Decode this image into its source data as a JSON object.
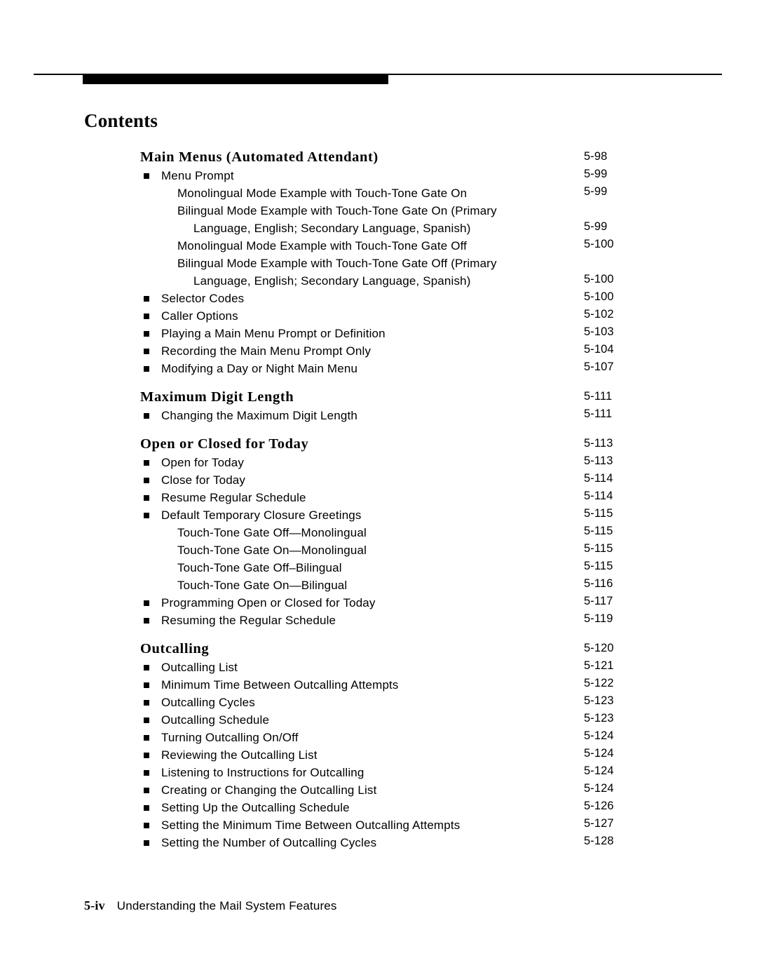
{
  "document": {
    "contents_title": "Contents",
    "footer": {
      "folio": "5-iv",
      "text": "Understanding the Mail System Features"
    }
  },
  "toc": {
    "entries": [
      {
        "type": "heading",
        "label": "Main Menus (Automated Attendant)",
        "page": "5-98"
      },
      {
        "type": "bullet",
        "label": "Menu Prompt",
        "page": "5-99"
      },
      {
        "type": "sub",
        "label": "Monolingual Mode Example with Touch-Tone Gate On",
        "page": "5-99"
      },
      {
        "type": "sub-wrap",
        "line1": "Bilingual Mode Example with Touch-Tone Gate On (Primary",
        "line2": "Language, English; Secondary Language, Spanish)",
        "page": "5-99"
      },
      {
        "type": "sub",
        "label": "Monolingual Mode Example with Touch-Tone Gate Off",
        "page": "5-100"
      },
      {
        "type": "sub-wrap",
        "line1": "Bilingual Mode Example with Touch-Tone Gate Off (Primary",
        "line2": "Language, English; Secondary Language, Spanish)",
        "page": "5-100"
      },
      {
        "type": "bullet",
        "label": "Selector Codes",
        "page": "5-100"
      },
      {
        "type": "bullet",
        "label": "Caller Options",
        "page": "5-102"
      },
      {
        "type": "bullet",
        "label": "Playing a Main Menu Prompt or Definition",
        "page": "5-103"
      },
      {
        "type": "bullet",
        "label": "Recording the Main Menu Prompt Only",
        "page": "5-104"
      },
      {
        "type": "bullet",
        "label": "Modifying a Day or Night Main Menu",
        "page": "5-107"
      },
      {
        "type": "heading",
        "label": "Maximum Digit Length",
        "page": "5-111"
      },
      {
        "type": "bullet",
        "label": "Changing the Maximum Digit Length",
        "page": "5-111"
      },
      {
        "type": "heading",
        "label": "Open or Closed for Today",
        "page": "5-113"
      },
      {
        "type": "bullet",
        "label": "Open for Today",
        "page": "5-113"
      },
      {
        "type": "bullet",
        "label": "Close for Today",
        "page": "5-114"
      },
      {
        "type": "bullet",
        "label": "Resume Regular Schedule",
        "page": "5-114"
      },
      {
        "type": "bullet",
        "label": "Default Temporary Closure Greetings",
        "page": "5-115"
      },
      {
        "type": "sub",
        "label": "Touch-Tone Gate Off—Monolingual",
        "page": "5-115"
      },
      {
        "type": "sub",
        "label": "Touch-Tone Gate On—Monolingual",
        "page": "5-115"
      },
      {
        "type": "sub",
        "label": "Touch-Tone Gate Off–Bilingual",
        "page": "5-115"
      },
      {
        "type": "sub",
        "label": "Touch-Tone Gate On—Bilingual",
        "page": "5-116"
      },
      {
        "type": "bullet",
        "label": "Programming Open or Closed for Today",
        "page": "5-117"
      },
      {
        "type": "bullet",
        "label": "Resuming the Regular Schedule",
        "page": "5-119"
      },
      {
        "type": "heading",
        "label": "Outcalling",
        "page": "5-120"
      },
      {
        "type": "bullet",
        "label": "Outcalling List",
        "page": "5-121"
      },
      {
        "type": "bullet",
        "label": "Minimum Time Between Outcalling Attempts",
        "page": "5-122"
      },
      {
        "type": "bullet",
        "label": "Outcalling Cycles",
        "page": "5-123"
      },
      {
        "type": "bullet",
        "label": "Outcalling Schedule",
        "page": "5-123"
      },
      {
        "type": "bullet",
        "label": "Turning Outcalling On/Off",
        "page": "5-124"
      },
      {
        "type": "bullet",
        "label": "Reviewing the Outcalling List",
        "page": "5-124"
      },
      {
        "type": "bullet",
        "label": "Listening to Instructions for Outcalling",
        "page": "5-124"
      },
      {
        "type": "bullet",
        "label": "Creating or Changing the Outcalling List",
        "page": "5-124"
      },
      {
        "type": "bullet",
        "label": "Setting Up the Outcalling Schedule",
        "page": "5-126"
      },
      {
        "type": "bullet",
        "label": "Setting the Minimum Time Between Outcalling Attempts",
        "page": "5-127"
      },
      {
        "type": "bullet",
        "label": "Setting the Number of Outcalling Cycles",
        "page": "5-128"
      }
    ]
  }
}
